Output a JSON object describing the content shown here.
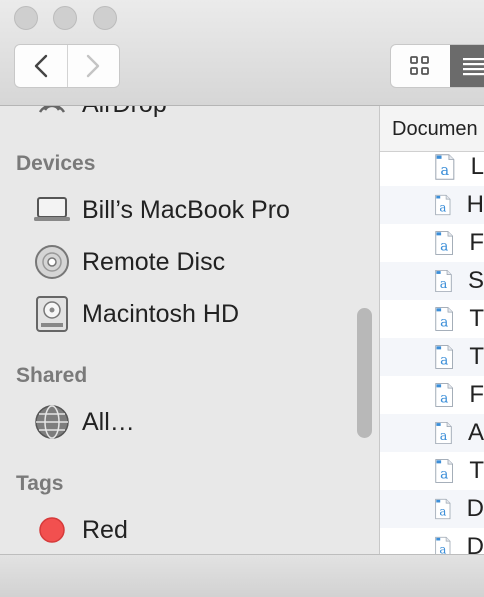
{
  "sidebar": {
    "partial_item": {
      "label": "AirDrop",
      "icon": "airdrop-icon"
    },
    "sections": [
      {
        "title": "Devices",
        "items": [
          {
            "label": "Bill’s MacBook Pro",
            "icon": "laptop-icon"
          },
          {
            "label": "Remote Disc",
            "icon": "disc-icon"
          },
          {
            "label": "Macintosh HD",
            "icon": "hard-drive-icon"
          }
        ]
      },
      {
        "title": "Shared",
        "items": [
          {
            "label": "All…",
            "icon": "network-globe-icon"
          }
        ]
      },
      {
        "title": "Tags",
        "items": [
          {
            "label": "Red",
            "icon": "red-tag-icon",
            "color": "#f2504f"
          }
        ]
      }
    ]
  },
  "content": {
    "column_header": "Documen",
    "rows": [
      {
        "initial": "L"
      },
      {
        "initial": "H"
      },
      {
        "initial": "F"
      },
      {
        "initial": "S"
      },
      {
        "initial": "T"
      },
      {
        "initial": "T"
      },
      {
        "initial": "F"
      },
      {
        "initial": "A"
      },
      {
        "initial": "T"
      },
      {
        "initial": "D"
      },
      {
        "initial": "D"
      }
    ]
  },
  "colors": {
    "accent": "#6b6b6b",
    "tag_red": "#f2504f",
    "doc_blue": "#3b8ed8"
  }
}
